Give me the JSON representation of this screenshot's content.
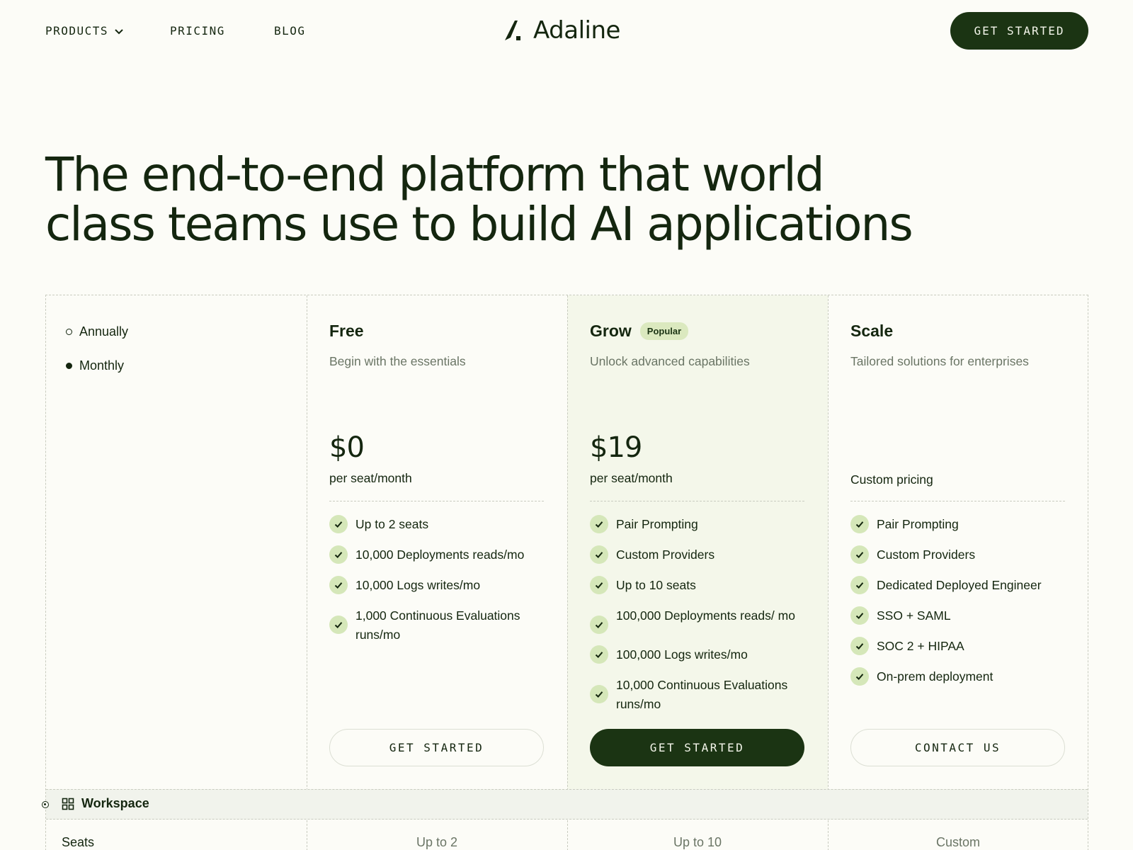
{
  "nav": {
    "products": "PRODUCTS",
    "pricing": "PRICING",
    "blog": "BLOG",
    "brand": "Adaline",
    "cta": "GET STARTED"
  },
  "hero": {
    "line1": "The end-to-end platform that world",
    "line2": "class teams use to build AI applications"
  },
  "billing": {
    "annually": "Annually",
    "monthly": "Monthly",
    "selected": "Monthly"
  },
  "plans": [
    {
      "name": "Free",
      "desc": "Begin with the essentials",
      "price": "$0",
      "unit": "per seat/month",
      "features": [
        "Up to 2 seats",
        "10,000 Deployments reads/mo",
        "10,000 Logs writes/mo",
        "1,000 Continuous Evaluations runs/mo"
      ],
      "button": "GET STARTED"
    },
    {
      "name": "Grow",
      "badge": "Popular",
      "desc": "Unlock advanced capabilities",
      "price": "$19",
      "unit": "per seat/month",
      "features": [
        "Pair Prompting",
        "Custom Providers",
        "Up to 10 seats",
        "100,000 Deployments reads/ mo",
        "100,000 Logs writes/mo",
        "10,000 Continuous Evaluations runs/mo"
      ],
      "button": "GET STARTED"
    },
    {
      "name": "Scale",
      "desc": "Tailored solutions for enterprises",
      "custom_price": "Custom pricing",
      "features": [
        "Pair Prompting",
        "Custom Providers",
        "Dedicated Deployed Engineer",
        "SSO + SAML",
        "SOC 2 + HIPAA",
        "On-prem deployment"
      ],
      "button": "CONTACT US"
    }
  ],
  "workspace": {
    "label": "Workspace",
    "seats_label": "Seats",
    "seats": [
      "Up to 2",
      "Up to 10",
      "Custom"
    ]
  },
  "colors": {
    "accent": "#1b3413",
    "background": "#fcfcf7",
    "check_bg": "#d5e7b9",
    "grow_bg": "#f4f7ea"
  }
}
